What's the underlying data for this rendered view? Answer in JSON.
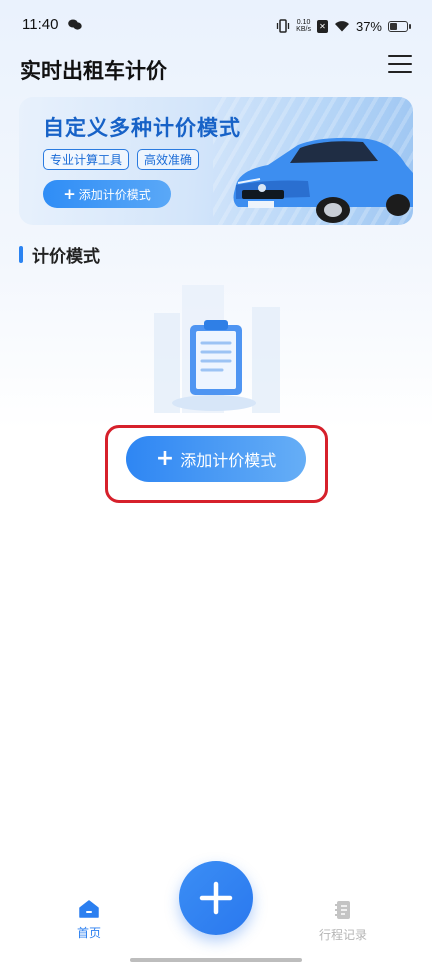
{
  "status_bar": {
    "time": "11:40",
    "net_speed_value": "0.10",
    "net_speed_unit": "KB/s",
    "battery_percent": "37%",
    "battery_level": 0.37
  },
  "header": {
    "title": "实时出租车计价",
    "menu_icon": "menu-icon"
  },
  "banner": {
    "title": "自定义多种计价模式",
    "tags": [
      "专业计算工具",
      "高效准确"
    ],
    "button_label": "添加计价模式"
  },
  "section": {
    "title": "计价模式"
  },
  "empty_state": {
    "button_label": "添加计价模式"
  },
  "bottom_nav": {
    "items": [
      {
        "label": "首页",
        "icon": "home-icon",
        "active": true
      },
      {
        "label": "行程记录",
        "icon": "notebook-icon",
        "active": false
      }
    ],
    "fab_icon": "plus-icon"
  },
  "colors": {
    "accent": "#2b83f1",
    "highlight": "#d6202b",
    "banner_title": "#1762c7"
  }
}
